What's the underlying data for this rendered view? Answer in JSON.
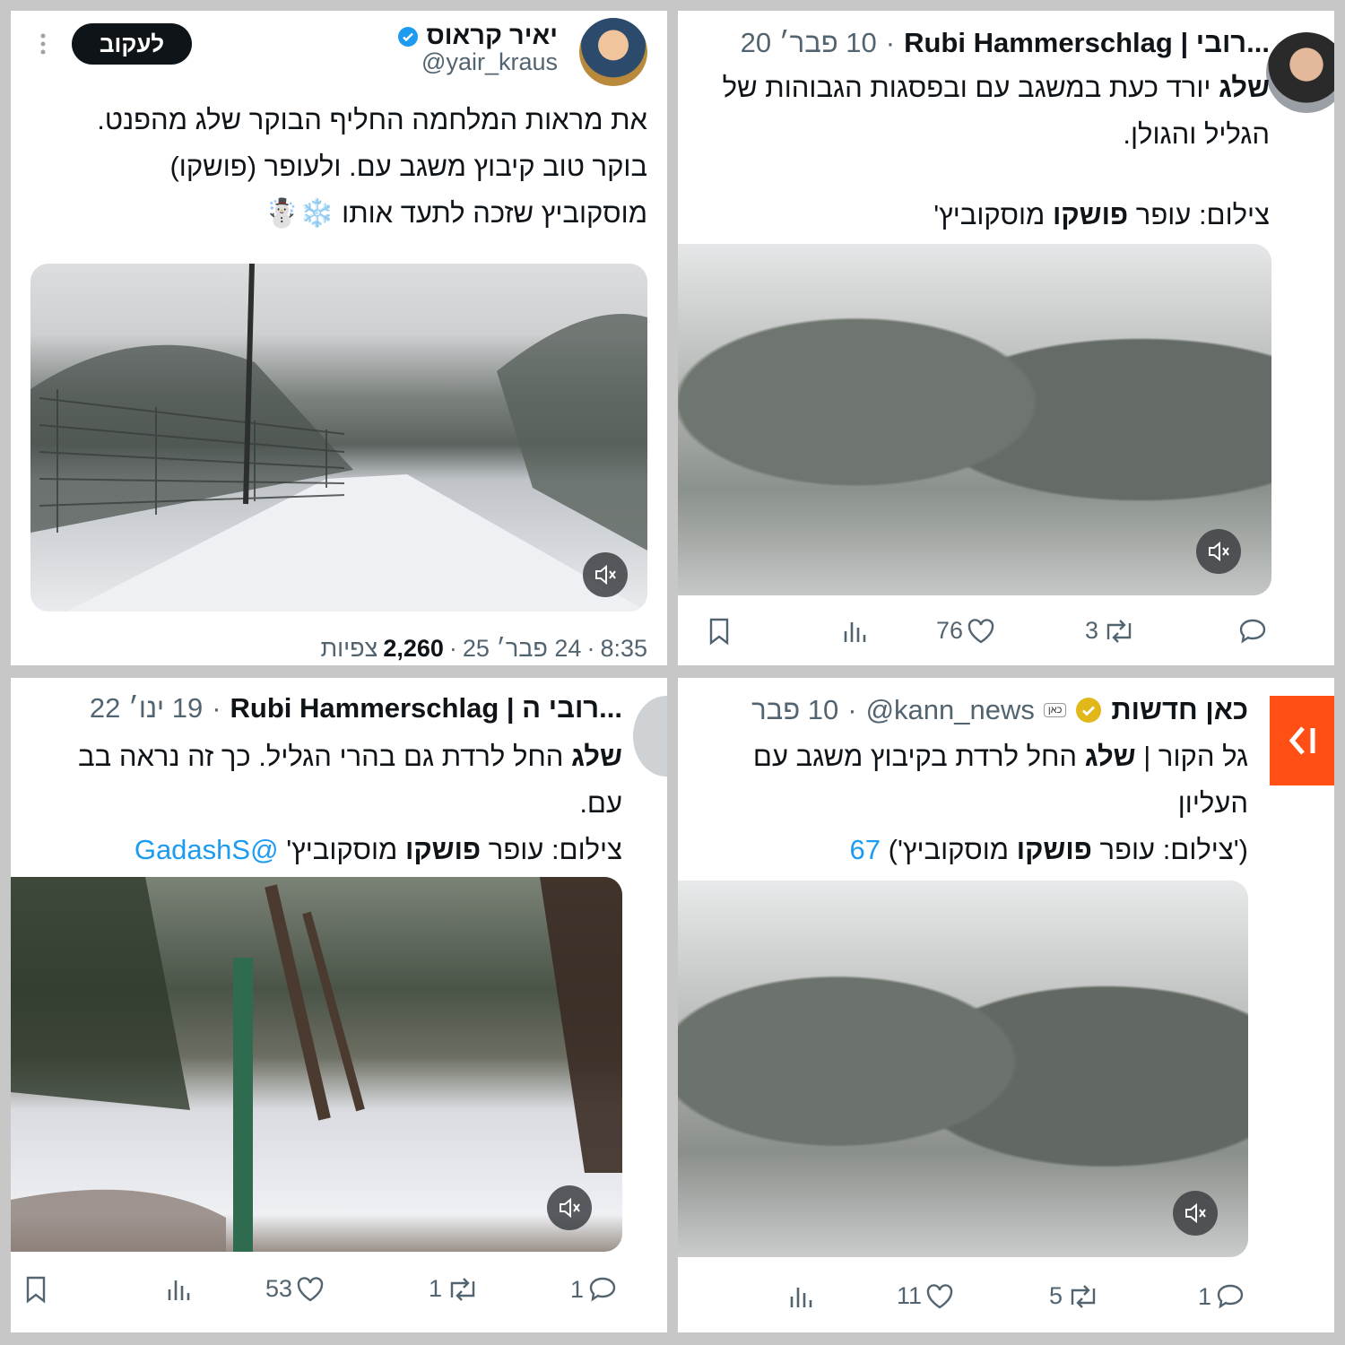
{
  "tweet_top_left": {
    "display_name": "יאיר קראוס",
    "handle": "@yair_kraus",
    "follow_label": "לעקוב",
    "line1": "את מראות המלחמה החליף הבוקר שלג מהפנט.",
    "line2": "בוקר טוב קיבוץ משגב עם. ולעופר (פושקו)",
    "line3": "מוסקוביץ שזכה לתעד אותו ❄️☃️",
    "time": "8:35",
    "date": "24 פבר׳ 25",
    "views_count": "2,260",
    "views_label": "צפיות"
  },
  "tweet_top_right": {
    "display_name": "...רובי | Rubi Hammerschlag",
    "date": "10 פבר׳ 20",
    "line1_bold": "שלג",
    "line1_rest": "יורד כעת במשגב עם ובפסגות הגבוהות של",
    "line2": "הגליל והגולן.",
    "credit_prefix": "צילום: עופר",
    "credit_bold": "פושקו",
    "credit_suffix": "מוסקוביץ'",
    "likes": "76",
    "retweets": "3"
  },
  "tweet_bottom_left": {
    "display_name": "...רובי ה | Rubi Hammerschlag",
    "date": "19 ינו׳ 22",
    "line1_bold": "שלג",
    "line1_rest": "החל לרדת גם בהרי הגליל. כך זה נראה בב",
    "line2": "עם.",
    "credit_prefix": "צילום: עופר",
    "credit_bold": "פושקו",
    "credit_suffix": "מוסקוביץ'",
    "mention": "@GadashS",
    "replies": "1",
    "retweets": "1",
    "likes": "53"
  },
  "tweet_bottom_right": {
    "display_name": "כאן חדשות",
    "org_badge": "כאן",
    "handle": "@kann_news",
    "date": "10 פבר",
    "line1_prefix": "גל הקור |",
    "line1_bold": "שלג",
    "line1_rest": "החל לרדת בקיבוץ משגב עם",
    "line2": "העליון",
    "credit": "('צילום: עופר",
    "credit_bold": "פושקו",
    "credit_suffix": "מוסקוביץ')",
    "credit_link": "67",
    "replies": "1",
    "retweets": "5",
    "likes": "11"
  },
  "icons": {
    "verified": "verified-badge-icon",
    "gold_verified": "gold-verified-badge-icon",
    "more": "more-vertical-icon",
    "mute": "volume-mute-icon",
    "bookmark": "bookmark-icon",
    "analytics": "analytics-icon",
    "like": "heart-icon",
    "retweet": "retweet-icon",
    "reply": "reply-icon",
    "collapse": "collapse-arrow-icon"
  },
  "colors": {
    "accent_blue": "#1d9bf0",
    "kan_orange": "#ff4f14",
    "gold": "#e2b719"
  }
}
